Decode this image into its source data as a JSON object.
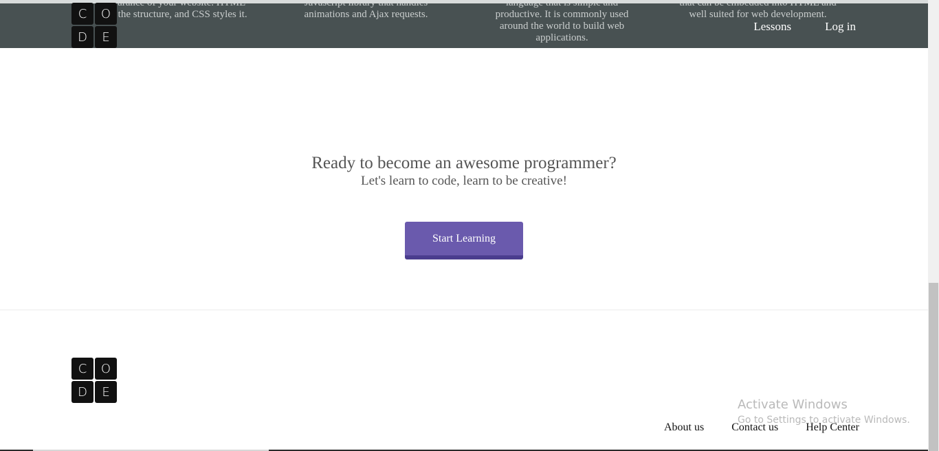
{
  "logo": {
    "letters": [
      "C",
      "O",
      "D",
      "E"
    ]
  },
  "header": {
    "nav": {
      "lessons": "Lessons",
      "login": "Log in"
    }
  },
  "under_header_text": {
    "col1": "appearance of your website. HTML adds the structure, and CSS styles it.",
    "col2": "Javascript library that handles animations and Ajax requests.",
    "col3": "language that is simple and productive. It is commonly used around the world to build web applications.",
    "col4": "that can be embedded into HTML and well suited for web development."
  },
  "cta": {
    "title": "Ready to become an awesome programmer?",
    "subtitle": "Let's learn to code, learn to be creative!",
    "button_label": "Start Learning"
  },
  "footer": {
    "links": {
      "about": "About us",
      "contact": "Contact us",
      "help": "Help Center"
    }
  },
  "watermark": {
    "line1": "Activate Windows",
    "line2": "Go to Settings to activate Windows."
  },
  "colors": {
    "header_bg": "#384243",
    "button_bg": "#6a5aad",
    "button_shadow": "#4a3d8e",
    "text_gray": "#555555"
  }
}
